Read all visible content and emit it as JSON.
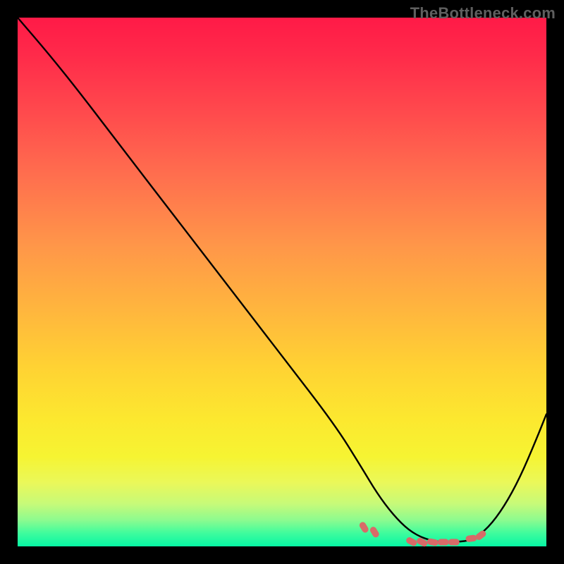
{
  "attribution": "TheBottleneck.com",
  "colors": {
    "background": "#000000",
    "attribution_text": "#5f5f5f",
    "curve": "#000000",
    "markers": "#d86a68",
    "gradient_top": "#ff1a47",
    "gradient_bottom": "#06f6a4"
  },
  "chart_data": {
    "type": "line",
    "title": "",
    "xlabel": "",
    "ylabel": "",
    "xlim": [
      0,
      100
    ],
    "ylim": [
      0,
      100
    ],
    "grid": false,
    "note": "Axes are unlabeled; values are percentages of the plot area read from pixels. Lower y at the minimum indicates the optimum (minimum bottleneck).",
    "series": [
      {
        "name": "bottleneck-curve",
        "x": [
          0,
          6,
          12,
          20,
          30,
          40,
          50,
          60,
          65,
          68,
          71,
          74,
          77,
          80,
          83,
          86,
          89,
          92,
          95,
          98,
          100
        ],
        "y": [
          100,
          93,
          85.5,
          75,
          62,
          49,
          36,
          23,
          15,
          10,
          6,
          3,
          1.4,
          0.8,
          0.8,
          1.2,
          3.5,
          7.5,
          13,
          20,
          25
        ]
      }
    ],
    "markers": {
      "name": "highlighted-points",
      "style": "rounded-ticks",
      "x": [
        65.5,
        67.5,
        74.5,
        76.5,
        78.5,
        80.5,
        82.5,
        85.8,
        87.6
      ],
      "y": [
        3.6,
        2.7,
        0.9,
        0.8,
        0.8,
        0.8,
        0.8,
        1.5,
        2.1
      ]
    },
    "gradient_background": {
      "direction": "vertical",
      "stops": [
        {
          "pos": 0.0,
          "color": "#ff1a47"
        },
        {
          "pos": 0.18,
          "color": "#ff4a4d"
        },
        {
          "pos": 0.43,
          "color": "#ff9649"
        },
        {
          "pos": 0.66,
          "color": "#ffd233"
        },
        {
          "pos": 0.83,
          "color": "#f6f432"
        },
        {
          "pos": 0.95,
          "color": "#8dfb8f"
        },
        {
          "pos": 1.0,
          "color": "#06f6a4"
        }
      ]
    }
  }
}
